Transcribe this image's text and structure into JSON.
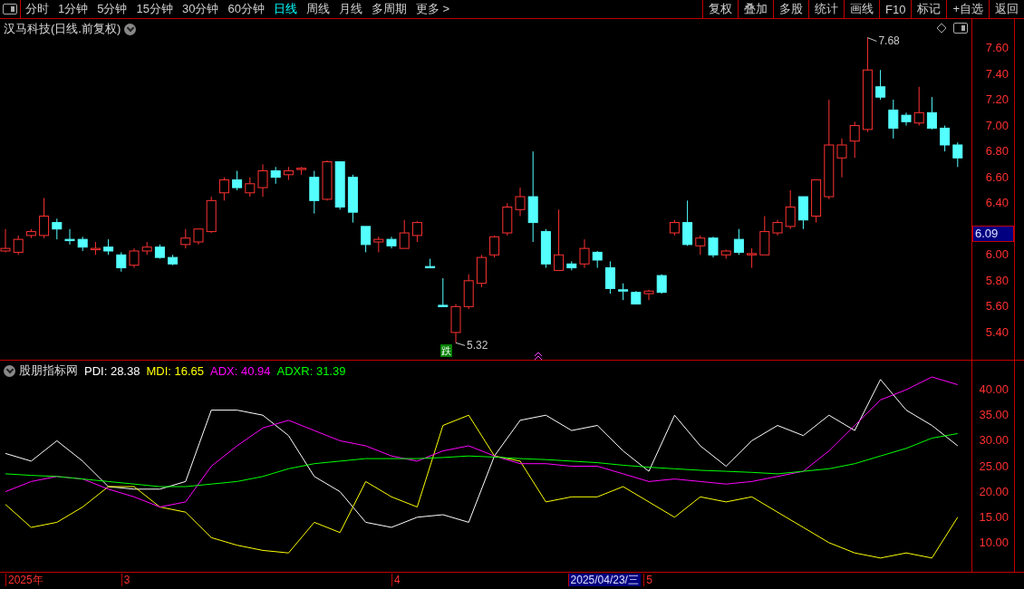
{
  "toolbar": {
    "periods": [
      {
        "label": "分时",
        "selected": false
      },
      {
        "label": "1分钟",
        "selected": false
      },
      {
        "label": "5分钟",
        "selected": false
      },
      {
        "label": "15分钟",
        "selected": false
      },
      {
        "label": "30分钟",
        "selected": false
      },
      {
        "label": "60分钟",
        "selected": false
      },
      {
        "label": "日线",
        "selected": true
      },
      {
        "label": "周线",
        "selected": false
      },
      {
        "label": "月线",
        "selected": false
      },
      {
        "label": "多周期",
        "selected": false
      },
      {
        "label": "更多 >",
        "selected": false
      }
    ],
    "buttons": [
      "复权",
      "叠加",
      "多股",
      "统计",
      "画线",
      "F10",
      "标记",
      "+自选",
      "返回"
    ]
  },
  "price_chart": {
    "title": "汉马科技(日线.前复权)",
    "high_label": "7.68",
    "low_label": "5.32",
    "signal_label": "跌",
    "current_price": "6.09",
    "chart_data": {
      "type": "candlestick",
      "ylim": [
        5.189,
        7.824
      ],
      "yticks": [
        {
          "value": 7.6,
          "label": "7.60"
        },
        {
          "value": 7.4,
          "label": "7.40"
        },
        {
          "value": 7.2,
          "label": "7.20"
        },
        {
          "value": 7.0,
          "label": "7.00"
        },
        {
          "value": 6.8,
          "label": "6.80"
        },
        {
          "value": 6.6,
          "label": "6.60"
        },
        {
          "value": 6.4,
          "label": "6.40"
        },
        {
          "value": 6.0,
          "label": "6.00"
        },
        {
          "value": 5.8,
          "label": "5.80"
        },
        {
          "value": 5.6,
          "label": "5.60"
        },
        {
          "value": 5.4,
          "label": "5.40"
        }
      ],
      "ohlc": [
        [
          6.03,
          6.2,
          6.02,
          6.05
        ],
        [
          6.02,
          6.15,
          6,
          6.12
        ],
        [
          6.15,
          6.2,
          6.13,
          6.18
        ],
        [
          6.15,
          6.44,
          6.13,
          6.3
        ],
        [
          6.25,
          6.28,
          6.12,
          6.2
        ],
        [
          6.12,
          6.2,
          6.08,
          6.11
        ],
        [
          6.12,
          6.14,
          6.03,
          6.06
        ],
        [
          6.04,
          6.1,
          6,
          6.05
        ],
        [
          6.06,
          6.12,
          6,
          6.03
        ],
        [
          6,
          6.02,
          5.87,
          5.9
        ],
        [
          5.92,
          6.05,
          5.9,
          6.03
        ],
        [
          6.03,
          6.1,
          6,
          6.06
        ],
        [
          6.06,
          6.08,
          5.97,
          5.98
        ],
        [
          5.98,
          6,
          5.92,
          5.93
        ],
        [
          6.08,
          6.2,
          6.05,
          6.13
        ],
        [
          6.1,
          6.2,
          6.08,
          6.2
        ],
        [
          6.18,
          6.45,
          6.17,
          6.42
        ],
        [
          6.48,
          6.6,
          6.42,
          6.58
        ],
        [
          6.58,
          6.65,
          6.5,
          6.52
        ],
        [
          6.48,
          6.6,
          6.45,
          6.55
        ],
        [
          6.52,
          6.7,
          6.45,
          6.65
        ],
        [
          6.65,
          6.68,
          6.55,
          6.6
        ],
        [
          6.62,
          6.68,
          6.58,
          6.65
        ],
        [
          6.66,
          6.68,
          6.62,
          6.67
        ],
        [
          6.6,
          6.65,
          6.32,
          6.42
        ],
        [
          6.43,
          6.73,
          6.42,
          6.72
        ],
        [
          6.72,
          6.72,
          6.35,
          6.37
        ],
        [
          6.6,
          6.62,
          6.25,
          6.33
        ],
        [
          6.22,
          6.22,
          6.02,
          6.08
        ],
        [
          6.1,
          6.14,
          6.02,
          6.12
        ],
        [
          6.12,
          6.14,
          6.05,
          6.07
        ],
        [
          6.05,
          6.27,
          6.05,
          6.17
        ],
        [
          6.15,
          6.26,
          6.1,
          6.25
        ],
        [
          5.91,
          5.97,
          5.9,
          5.9
        ],
        [
          5.61,
          5.82,
          5.6,
          5.6
        ],
        [
          5.4,
          5.62,
          5.32,
          5.6
        ],
        [
          5.6,
          5.85,
          5.58,
          5.8
        ],
        [
          5.78,
          6,
          5.75,
          5.98
        ],
        [
          6,
          6.15,
          5.98,
          6.14
        ],
        [
          6.17,
          6.4,
          6.15,
          6.37
        ],
        [
          6.35,
          6.52,
          6.3,
          6.45
        ],
        [
          6.45,
          6.8,
          6.1,
          6.25
        ],
        [
          6.18,
          6.2,
          5.9,
          5.93
        ],
        [
          5.88,
          6.35,
          5.88,
          6
        ],
        [
          5.93,
          5.95,
          5.88,
          5.9
        ],
        [
          5.93,
          6.12,
          5.9,
          6.05
        ],
        [
          6.02,
          6.03,
          5.9,
          5.96
        ],
        [
          5.9,
          5.95,
          5.7,
          5.74
        ],
        [
          5.73,
          5.78,
          5.65,
          5.72
        ],
        [
          5.71,
          5.72,
          5.62,
          5.62
        ],
        [
          5.7,
          5.73,
          5.65,
          5.72
        ],
        [
          5.84,
          5.85,
          5.7,
          5.71
        ],
        [
          6.17,
          6.27,
          6.15,
          6.25
        ],
        [
          6.25,
          6.42,
          6.07,
          6.08
        ],
        [
          6.07,
          6.15,
          6,
          6.13
        ],
        [
          6.13,
          6.14,
          5.98,
          6
        ],
        [
          6,
          6.04,
          5.97,
          6.03
        ],
        [
          6.12,
          6.2,
          6,
          6.02
        ],
        [
          6,
          6.05,
          5.9,
          6.01
        ],
        [
          6,
          6.3,
          6,
          6.18
        ],
        [
          6.17,
          6.27,
          6.15,
          6.25
        ],
        [
          6.22,
          6.5,
          6.2,
          6.37
        ],
        [
          6.45,
          6.45,
          6.2,
          6.27
        ],
        [
          6.3,
          6.58,
          6.25,
          6.58
        ],
        [
          6.45,
          7.2,
          6.43,
          6.85
        ],
        [
          6.75,
          6.9,
          6.6,
          6.85
        ],
        [
          6.88,
          7.03,
          6.75,
          7
        ],
        [
          6.97,
          7.68,
          6.95,
          7.43
        ],
        [
          7.3,
          7.43,
          7.2,
          7.22
        ],
        [
          7.12,
          7.2,
          6.9,
          6.98
        ],
        [
          7.08,
          7.1,
          7,
          7.03
        ],
        [
          7.02,
          7.3,
          7,
          7.1
        ],
        [
          7.1,
          7.22,
          6.97,
          6.98
        ],
        [
          6.98,
          7,
          6.8,
          6.85
        ],
        [
          6.85,
          6.87,
          6.68,
          6.75
        ]
      ]
    }
  },
  "indicator": {
    "name": "股朋指标网",
    "legend_values": [
      ": 28.38",
      ": 16.65",
      ": 40.94",
      ": 31.39"
    ],
    "chart_data": {
      "type": "line",
      "ylim": [
        4.3,
        45.7
      ],
      "yticks": [
        {
          "value": 40,
          "label": "40.00"
        },
        {
          "value": 35,
          "label": "35.00"
        },
        {
          "value": 30,
          "label": "30.00"
        },
        {
          "value": 25,
          "label": "25.00"
        },
        {
          "value": 20,
          "label": "20.00"
        },
        {
          "value": 15,
          "label": "15.00"
        },
        {
          "value": 10,
          "label": "10.00"
        }
      ],
      "series": [
        {
          "name": "PDI",
          "color": "#ffffff",
          "values": [
            27.5,
            26,
            30,
            26,
            21,
            20.5,
            20.5,
            22,
            36,
            36,
            35,
            31,
            23,
            20,
            14,
            13,
            15,
            15.5,
            14,
            27,
            34,
            35,
            32,
            33,
            28,
            24,
            35,
            29,
            25,
            30,
            33,
            31,
            35,
            32,
            42,
            36,
            33,
            29
          ]
        },
        {
          "name": "MDI",
          "color": "#ffff00",
          "values": [
            17.5,
            13,
            14,
            17,
            21,
            21,
            17,
            16,
            11,
            9.5,
            8.5,
            8,
            14,
            12,
            22,
            19,
            17,
            33,
            35,
            27,
            26,
            18,
            19,
            19,
            21,
            18,
            15,
            19,
            18,
            19,
            16,
            13,
            10,
            8,
            7,
            8,
            7,
            15
          ]
        },
        {
          "name": "ADX",
          "color": "#ff00ff",
          "values": [
            20,
            22,
            23,
            22.5,
            20.5,
            19,
            17,
            18,
            25,
            29,
            32.5,
            34,
            32,
            30,
            29,
            27,
            26,
            28,
            29,
            27,
            25.5,
            25.5,
            25,
            25,
            23.5,
            22,
            22.5,
            22,
            21.5,
            22,
            23,
            24,
            28,
            33,
            38,
            40,
            42.5,
            41
          ]
        },
        {
          "name": "ADXR",
          "color": "#00ff00",
          "values": [
            23.5,
            23.2,
            23,
            22.5,
            22,
            21.5,
            21,
            21,
            21.5,
            22,
            23,
            24.5,
            25.5,
            26,
            26.5,
            26.5,
            26.5,
            26.7,
            27,
            26.8,
            26.5,
            26.3,
            26,
            25.7,
            25.2,
            24.8,
            24.5,
            24.2,
            24,
            23.8,
            23.5,
            24,
            24.5,
            25.5,
            27,
            28.5,
            30.5,
            31.4
          ]
        }
      ]
    }
  },
  "date_bar": [
    {
      "text": "2025年",
      "kind": "label"
    },
    {
      "text": "3",
      "kind": "label"
    },
    {
      "text": "4",
      "kind": "label"
    },
    {
      "text": "2025/04/23/三",
      "kind": "cursor"
    },
    {
      "text": "5",
      "kind": "label"
    }
  ]
}
